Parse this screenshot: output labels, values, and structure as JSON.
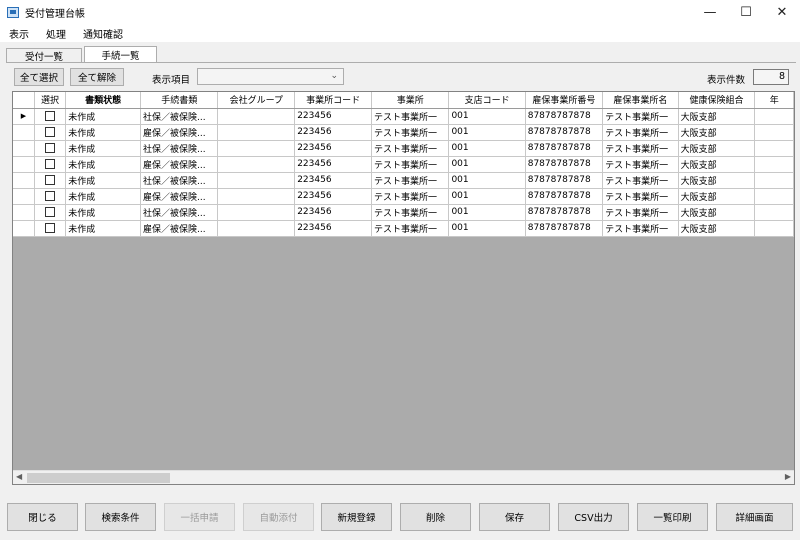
{
  "window": {
    "title": "受付管理台帳",
    "controls": {
      "minimize": "—",
      "maximize": "☐",
      "close": "✕"
    }
  },
  "menu": [
    "表示",
    "処理",
    "通知確認"
  ],
  "tabs": [
    "受付一覧",
    "手続一覧"
  ],
  "toolbar": {
    "select_all": "全て選択",
    "deselect_all": "全て解除",
    "display_item_label": "表示項目",
    "display_item_value": "",
    "count_label": "表示件数",
    "count_value": "8"
  },
  "grid": {
    "columns": [
      "選択",
      "書類状態",
      "手続書類",
      "会社グループ",
      "事業所コード",
      "事業所",
      "支店コード",
      "雇保事業所番号",
      "雇保事業所名",
      "健康保険組合",
      "年"
    ],
    "rows": [
      [
        "未作成",
        "社保／被保険...",
        "",
        "223456",
        "テスト事業所一",
        "001",
        "87878787878",
        "テスト事業所一",
        "大阪支部"
      ],
      [
        "未作成",
        "雇保／被保険...",
        "",
        "223456",
        "テスト事業所一",
        "001",
        "87878787878",
        "テスト事業所一",
        "大阪支部"
      ],
      [
        "未作成",
        "社保／被保険...",
        "",
        "223456",
        "テスト事業所一",
        "001",
        "87878787878",
        "テスト事業所一",
        "大阪支部"
      ],
      [
        "未作成",
        "雇保／被保険...",
        "",
        "223456",
        "テスト事業所一",
        "001",
        "87878787878",
        "テスト事業所一",
        "大阪支部"
      ],
      [
        "未作成",
        "社保／被保険...",
        "",
        "223456",
        "テスト事業所一",
        "001",
        "87878787878",
        "テスト事業所一",
        "大阪支部"
      ],
      [
        "未作成",
        "雇保／被保険...",
        "",
        "223456",
        "テスト事業所一",
        "001",
        "87878787878",
        "テスト事業所一",
        "大阪支部"
      ],
      [
        "未作成",
        "社保／被保険...",
        "",
        "223456",
        "テスト事業所一",
        "001",
        "87878787878",
        "テスト事業所一",
        "大阪支部"
      ],
      [
        "未作成",
        "雇保／被保険...",
        "",
        "223456",
        "テスト事業所一",
        "001",
        "87878787878",
        "テスト事業所一",
        "大阪支部"
      ]
    ],
    "current_row_marker": "▶"
  },
  "bottom_buttons": {
    "close": "閉じる",
    "search": "検索条件",
    "bulk_apply": "一括申請",
    "auto_attach": "自動添付",
    "new": "新規登録",
    "delete": "削除",
    "save": "保存",
    "csv": "CSV出力",
    "print_list": "一覧印刷",
    "detail": "詳細画面"
  }
}
